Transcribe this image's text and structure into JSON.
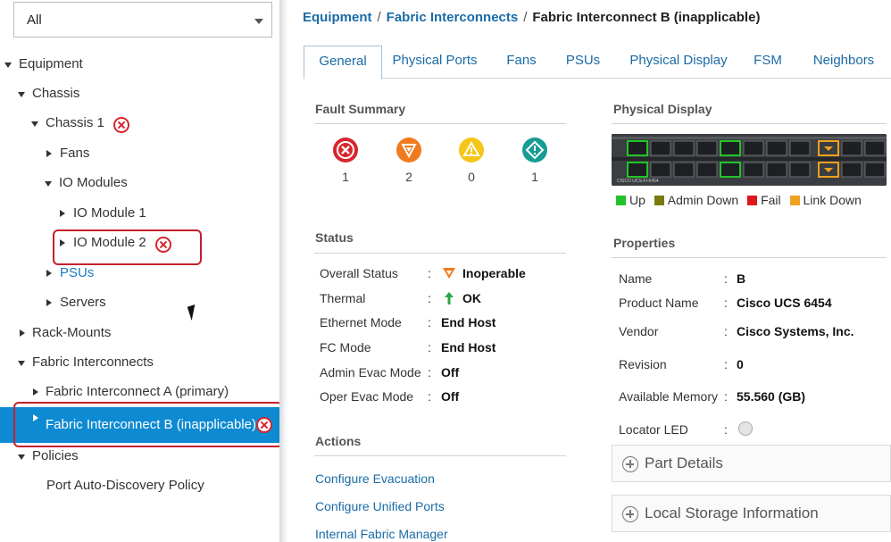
{
  "filter": {
    "value": "All"
  },
  "tree": {
    "equipment": "Equipment",
    "chassis": "Chassis",
    "chassis1": "Chassis 1",
    "fans": "Fans",
    "io_modules": "IO Modules",
    "io_module1": "IO Module 1",
    "io_module2": "IO Module 2",
    "psus": "PSUs",
    "servers": "Servers",
    "rack_mounts": "Rack-Mounts",
    "fabric_interconnects": "Fabric Interconnects",
    "fi_a": "Fabric Interconnect A (primary)",
    "fi_b": "Fabric Interconnect B (inapplicable)",
    "policies": "Policies",
    "port_auto_discovery": "Port Auto-Discovery Policy"
  },
  "breadcrumb": {
    "item1": "Equipment",
    "item2": "Fabric Interconnects",
    "current": "Fabric Interconnect B (inapplicable)",
    "separator": "/"
  },
  "tabs": [
    "General",
    "Physical Ports",
    "Fans",
    "PSUs",
    "Physical Display",
    "FSM",
    "Neighbors"
  ],
  "fault_summary": {
    "title": "Fault Summary",
    "critical": "1",
    "major": "2",
    "minor": "0",
    "warning": "1",
    "colors": {
      "critical": "#d8252e",
      "major": "#f07b1e",
      "minor": "#f5c518",
      "warning": "#169c94"
    }
  },
  "status": {
    "title": "Status",
    "rows": [
      {
        "label": "Overall Status",
        "value": "Inoperable"
      },
      {
        "label": "Thermal",
        "value": "OK"
      },
      {
        "label": "Ethernet Mode",
        "value": "End Host"
      },
      {
        "label": "FC Mode",
        "value": "End Host"
      },
      {
        "label": "Admin Evac Mode",
        "value": "Off"
      },
      {
        "label": "Oper Evac Mode",
        "value": "Off"
      }
    ],
    "colon": ":"
  },
  "actions": {
    "title": "Actions",
    "links": [
      "Configure Evacuation",
      "Configure Unified Ports",
      "Internal Fabric Manager"
    ]
  },
  "physical_display": {
    "title": "Physical Display",
    "device_label": "CISCO UCS-FI-6454",
    "legend": [
      {
        "label": "Up",
        "color": "#22c32a"
      },
      {
        "label": "Admin Down",
        "color": "#7a7a10"
      },
      {
        "label": "Fail",
        "color": "#e0161b"
      },
      {
        "label": "Link Down",
        "color": "#f0a020"
      }
    ]
  },
  "properties": {
    "title": "Properties",
    "rows": [
      {
        "label": "Name",
        "value": "B"
      },
      {
        "label": "Product Name",
        "value": "Cisco UCS 6454"
      },
      {
        "label": "Vendor",
        "value": "Cisco Systems, Inc."
      },
      {
        "label": "Revision",
        "value": "0"
      },
      {
        "label": "Available Memory",
        "value": "55.560 (GB)"
      },
      {
        "label": "Locator LED",
        "value": ""
      }
    ]
  },
  "expanders": {
    "part_details": "Part Details",
    "local_storage": "Local Storage Information"
  }
}
